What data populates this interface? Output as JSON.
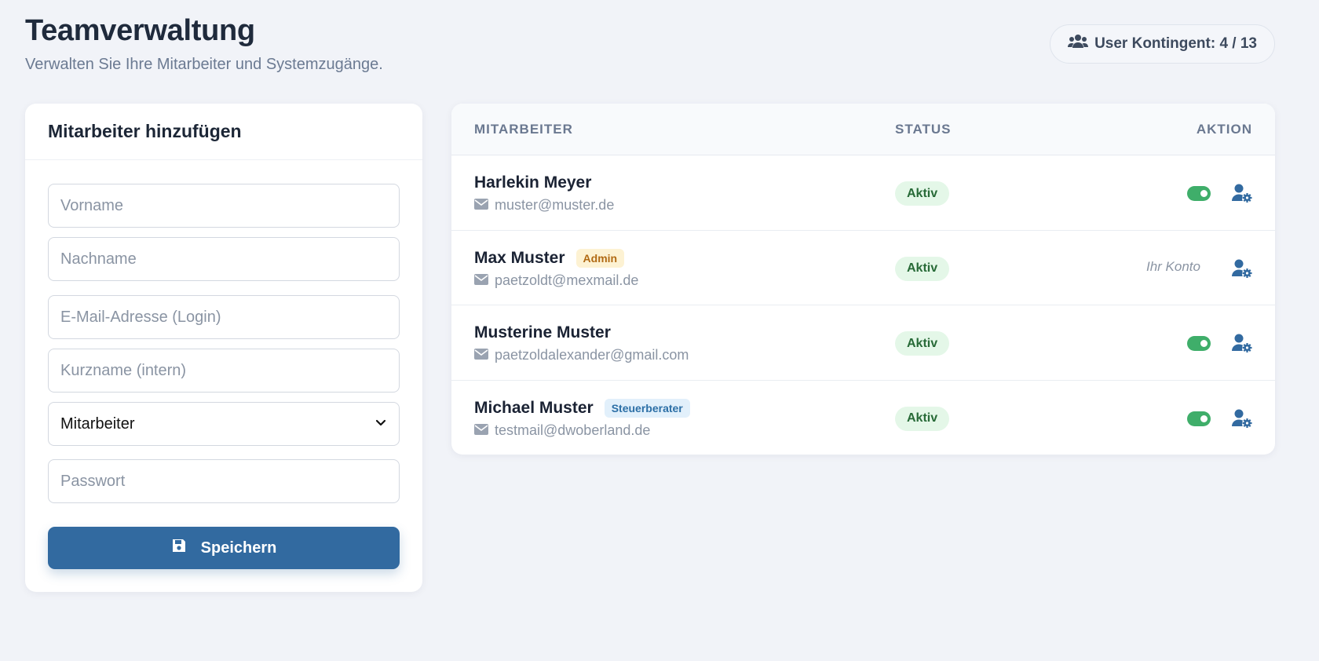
{
  "header": {
    "title": "Teamverwaltung",
    "subtitle": "Verwalten Sie Ihre Mitarbeiter und Systemzugänge.",
    "quota_label": "User Kontingent: 4 / 13",
    "quota_icon": "users-icon"
  },
  "form": {
    "title": "Mitarbeiter hinzufügen",
    "firstname_placeholder": "Vorname",
    "lastname_placeholder": "Nachname",
    "email_placeholder": "E-Mail-Adresse (Login)",
    "shortname_placeholder": "Kurzname (intern)",
    "role_selected": "Mitarbeiter",
    "password_placeholder": "Passwort",
    "save_label": "Speichern",
    "save_icon": "floppy-disk-icon"
  },
  "table": {
    "columns": {
      "name": "MITARBEITER",
      "status": "STATUS",
      "action": "AKTION"
    },
    "rows": [
      {
        "name": "Harlekin Meyer",
        "role": "",
        "email": "muster@muster.de",
        "status": "Aktiv",
        "action_text": ""
      },
      {
        "name": "Max Muster",
        "role": "Admin",
        "email": "paetzoldt@mexmail.de",
        "status": "Aktiv",
        "action_text": "Ihr Konto"
      },
      {
        "name": "Musterine Muster",
        "role": "",
        "email": "paetzoldalexander@gmail.com",
        "status": "Aktiv",
        "action_text": ""
      },
      {
        "name": "Michael Muster",
        "role": "Steuerberater",
        "email": "testmail@dwoberland.de",
        "status": "Aktiv",
        "action_text": ""
      }
    ]
  },
  "colors": {
    "accent": "#326aa0",
    "status_active_bg": "#e4f7e8",
    "status_active_text": "#276a37",
    "toggle_on": "#3fae6a",
    "admin_badge_bg": "#fdf2d3",
    "tax_badge_bg": "#e2f0fb"
  }
}
